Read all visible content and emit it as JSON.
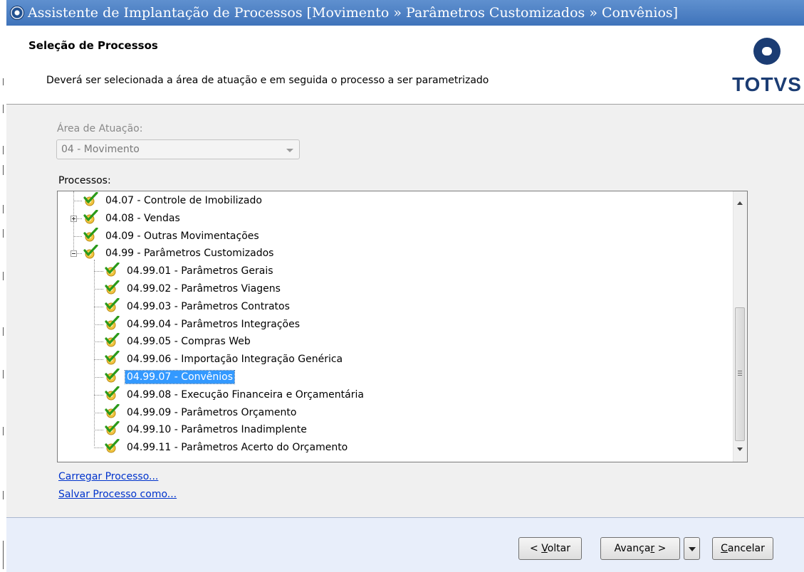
{
  "window": {
    "title": "Assistente de Implantação de Processos [Movimento » Parâmetros Customizados  » Convênios]"
  },
  "header": {
    "title": "Seleção de Processos",
    "description": "Deverá ser selecionada a área de atuação e em seguida o processo a ser parametrizado",
    "logo_text": "TOTVS"
  },
  "area": {
    "label": "Área de Atuação:",
    "selected": "04 - Movimento"
  },
  "processes": {
    "label": "Processos:",
    "items": [
      {
        "label": "04.07 - Controle de Imobilizado",
        "level": 1,
        "expander": "none",
        "selected": false
      },
      {
        "label": "04.08 - Vendas",
        "level": 1,
        "expander": "plus",
        "selected": false
      },
      {
        "label": "04.09 - Outras Movimentações",
        "level": 1,
        "expander": "none",
        "selected": false
      },
      {
        "label": "04.99 - Parâmetros Customizados",
        "level": 1,
        "expander": "minus",
        "selected": false
      },
      {
        "label": "04.99.01 - Parâmetros Gerais",
        "level": 2,
        "expander": "none",
        "selected": false
      },
      {
        "label": "04.99.02 - Parâmetros Viagens",
        "level": 2,
        "expander": "none",
        "selected": false
      },
      {
        "label": "04.99.03 - Parâmetros Contratos",
        "level": 2,
        "expander": "none",
        "selected": false
      },
      {
        "label": "04.99.04 - Parâmetros Integrações",
        "level": 2,
        "expander": "none",
        "selected": false
      },
      {
        "label": "04.99.05 - Compras Web",
        "level": 2,
        "expander": "none",
        "selected": false
      },
      {
        "label": "04.99.06 - Importação Integração Genérica",
        "level": 2,
        "expander": "none",
        "selected": false
      },
      {
        "label": "04.99.07 - Convênios",
        "level": 2,
        "expander": "none",
        "selected": true
      },
      {
        "label": "04.99.08 - Execução Financeira e Orçamentária",
        "level": 2,
        "expander": "none",
        "selected": false
      },
      {
        "label": "04.99.09 - Parâmetros Orçamento",
        "level": 2,
        "expander": "none",
        "selected": false
      },
      {
        "label": "04.99.10 - Parâmetros Inadimplente",
        "level": 2,
        "expander": "none",
        "selected": false
      },
      {
        "label": "04.99.11 - Parâmetros Acerto do Orçamento",
        "level": 2,
        "expander": "none",
        "selected": false
      }
    ]
  },
  "links": {
    "load": "Carregar Processo...",
    "save_as": "Salvar Processo como..."
  },
  "buttons": {
    "back_prefix": "< ",
    "back_accel": "V",
    "back_rest": "oltar",
    "next_pre": "Avança",
    "next_accel": "r",
    "next_post": " >",
    "cancel_accel": "C",
    "cancel_rest": "ancelar"
  },
  "colors": {
    "titlebar": "#4a7fc4",
    "selection": "#3399ff",
    "link": "#0033cc",
    "footer": "#e8eefa",
    "logo": "#1b3c73"
  }
}
